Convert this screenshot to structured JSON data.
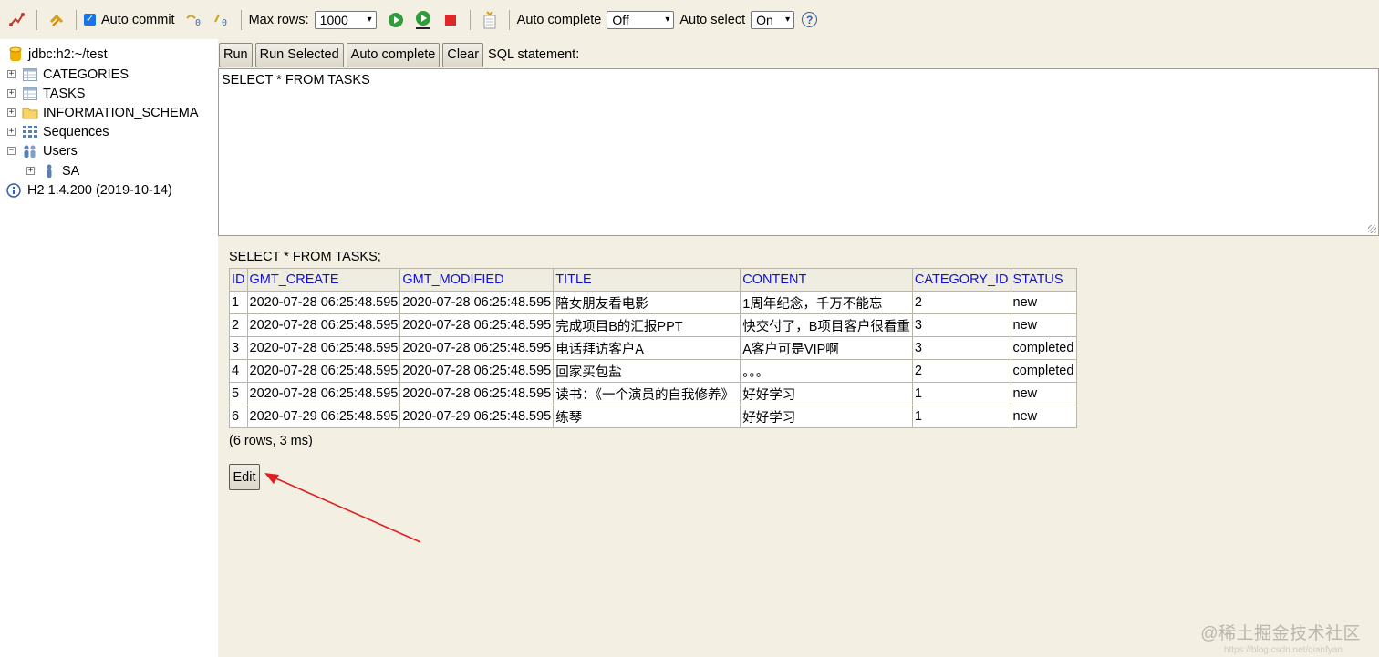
{
  "toolbar": {
    "auto_commit_label": "Auto commit",
    "max_rows_label": "Max rows:",
    "max_rows_value": "1000",
    "auto_complete_label": "Auto complete",
    "auto_complete_value": "Off",
    "auto_select_label": "Auto select",
    "auto_select_value": "On",
    "help_glyph": "?"
  },
  "tree": {
    "connection": "jdbc:h2:~/test",
    "items": [
      {
        "label": "CATEGORIES",
        "icon": "table-icon"
      },
      {
        "label": "TASKS",
        "icon": "table-icon"
      },
      {
        "label": "INFORMATION_SCHEMA",
        "icon": "folder-icon"
      },
      {
        "label": "Sequences",
        "icon": "sequences-icon"
      },
      {
        "label": "Users",
        "icon": "users-icon"
      }
    ],
    "user": "SA",
    "version": "H2 1.4.200 (2019-10-14)"
  },
  "buttons": {
    "run": "Run",
    "run_selected": "Run Selected",
    "auto_complete": "Auto complete",
    "clear": "Clear",
    "sql_label": "SQL statement:"
  },
  "sql_text": "SELECT * FROM TASKS",
  "results": {
    "query": "SELECT * FROM TASKS;",
    "columns": [
      "ID",
      "GMT_CREATE",
      "GMT_MODIFIED",
      "TITLE",
      "CONTENT",
      "CATEGORY_ID",
      "STATUS"
    ],
    "rows": [
      [
        "1",
        "2020-07-28 06:25:48.595",
        "2020-07-28 06:25:48.595",
        "陪女朋友看电影",
        "1周年纪念，千万不能忘",
        "2",
        "new"
      ],
      [
        "2",
        "2020-07-28 06:25:48.595",
        "2020-07-28 06:25:48.595",
        "完成项目B的汇报PPT",
        "快交付了，B项目客户很看重",
        "3",
        "new"
      ],
      [
        "3",
        "2020-07-28 06:25:48.595",
        "2020-07-28 06:25:48.595",
        "电话拜访客户A",
        "A客户可是VIP啊",
        "3",
        "completed"
      ],
      [
        "4",
        "2020-07-28 06:25:48.595",
        "2020-07-28 06:25:48.595",
        "回家买包盐",
        "。。。",
        "2",
        "completed"
      ],
      [
        "5",
        "2020-07-28 06:25:48.595",
        "2020-07-28 06:25:48.595",
        "读书：《一个演员的自我修养》",
        "好好学习",
        "1",
        "new"
      ],
      [
        "6",
        "2020-07-29 06:25:48.595",
        "2020-07-29 06:25:48.595",
        "练琴",
        "好好学习",
        "1",
        "new"
      ]
    ],
    "info": "(6 rows, 3 ms)",
    "edit_label": "Edit"
  },
  "watermark": "@稀土掘金技术社区",
  "watermark_url": "https://blog.csdn.net/qianfyan",
  "colors": {
    "header_text": "#1010d6",
    "annotation_arrow": "#e02020",
    "background": "#f3efe2"
  }
}
